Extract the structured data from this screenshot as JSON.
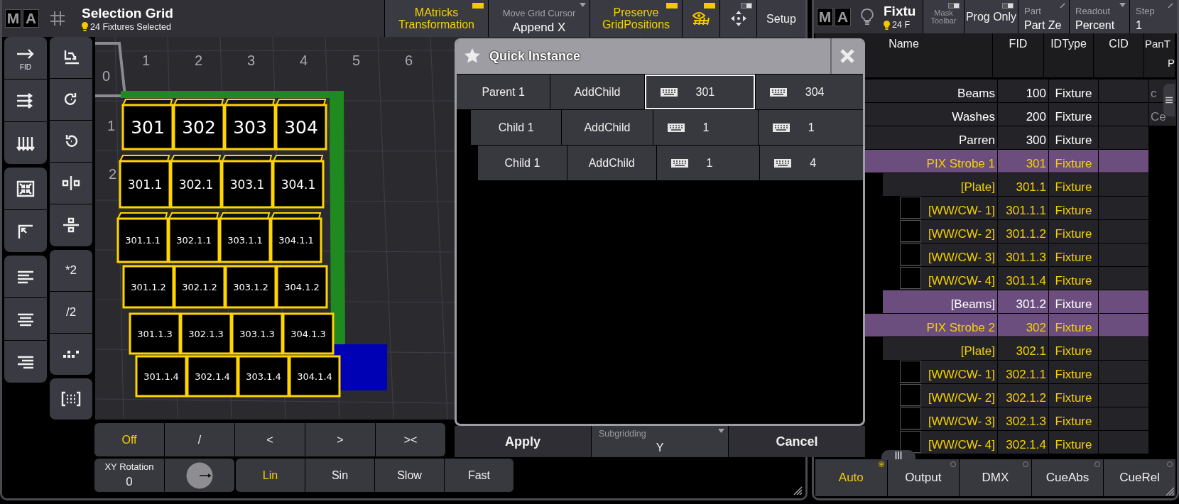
{
  "selection_grid": {
    "logo": [
      "M",
      "A"
    ],
    "title": "Selection Grid",
    "subtitle": "24 Fixtures Selected",
    "toolbar": [
      {
        "kind": "toggle",
        "label": "MAtricks Transformation",
        "on": true
      },
      {
        "kind": "select",
        "caption": "Move Grid Cursor",
        "value": "Append X"
      },
      {
        "kind": "toggle",
        "label": "Preserve GridPositions",
        "on": true
      },
      {
        "kind": "viewtoggle",
        "on": true
      },
      {
        "kind": "movetoggle",
        "on": false
      },
      {
        "kind": "button",
        "label": "Setup"
      }
    ],
    "tools": {
      "fid_label": "FID",
      "multiply_label": "*2",
      "divide_label": "/2"
    },
    "grid": {
      "x_labels": [
        "1",
        "2",
        "3",
        "4",
        "5",
        "6"
      ],
      "y_labels": [
        "0",
        "1",
        "2"
      ],
      "rows": [
        [
          "301",
          "302",
          "303",
          "304"
        ],
        [
          "301.1",
          "302.1",
          "303.1",
          "304.1"
        ],
        [
          "301.1.1",
          "302.1.1",
          "303.1.1",
          "304.1.1"
        ],
        [
          "301.1.2",
          "302.1.2",
          "303.1.2",
          "304.1.2"
        ],
        [
          "301.1.3",
          "302.1.3",
          "303.1.3",
          "304.1.3"
        ],
        [
          "301.1.4",
          "302.1.4",
          "303.1.4",
          "304.1.4"
        ]
      ]
    },
    "fade_modes": [
      {
        "label": "Off",
        "selected": true
      },
      {
        "label": "/",
        "selected": false
      },
      {
        "label": "<",
        "selected": false
      },
      {
        "label": ">",
        "selected": false
      },
      {
        "label": "><",
        "selected": false
      }
    ],
    "xy_rotation": {
      "caption": "XY Rotation",
      "value": "0"
    },
    "curves": [
      {
        "label": "Lin",
        "selected": true
      },
      {
        "label": "Sin",
        "selected": false
      },
      {
        "label": "Slow",
        "selected": false
      },
      {
        "label": "Fast",
        "selected": false
      }
    ]
  },
  "quick_instance": {
    "title": "Quick Instance",
    "rows": [
      {
        "name": "Parent 1",
        "action": "AddChild",
        "from": "301",
        "to": "304",
        "from_focused": true,
        "to_focused": false,
        "children": [
          {
            "name": "Child 1",
            "action": "AddChild",
            "from": "1",
            "to": "1",
            "from_focused": false,
            "to_focused": false,
            "children": [
              {
                "name": "Child 1",
                "action": "AddChild",
                "from": "1",
                "to": "4",
                "from_focused": false,
                "to_focused": false
              }
            ]
          }
        ]
      }
    ],
    "apply": "Apply",
    "subgridding": {
      "caption": "Subgridding",
      "value": "Y"
    },
    "cancel": "Cancel"
  },
  "fixture_sheet": {
    "logo": [
      "M",
      "A"
    ],
    "title": "Fixtu",
    "subtitle": "24 F",
    "toolbar": [
      {
        "kind": "toggle",
        "label": "Mask Toolbar",
        "on": false,
        "disabled": true
      },
      {
        "kind": "toggle",
        "label": "Prog Only",
        "on": false,
        "disabled": false
      },
      {
        "kind": "edit",
        "caption": "Part",
        "value": "Part Ze"
      },
      {
        "kind": "select",
        "caption": "Readout",
        "value": "Percent"
      },
      {
        "kind": "edit",
        "caption": "Step",
        "value": "1"
      }
    ],
    "columns": [
      {
        "label": "Name"
      },
      {
        "label": "FID"
      },
      {
        "label": "IDType"
      },
      {
        "label": "CID"
      },
      {
        "label": "PanT",
        "unit": "P"
      }
    ],
    "rows": [
      {
        "name": "Beams",
        "fid": "100",
        "idtype": "Fixture",
        "column_5": "c",
        "selected": false,
        "highlighted": false
      },
      {
        "name": "Washes",
        "fid": "200",
        "idtype": "Fixture",
        "column_5": "Ce",
        "selected": false,
        "highlighted": false
      },
      {
        "name": "Parren",
        "fid": "300",
        "idtype": "Fixture",
        "selected": false,
        "highlighted": false
      },
      {
        "name": "PIX Strobe 1",
        "fid": "301",
        "idtype": "Fixture",
        "selected": true,
        "highlighted": true,
        "children": [
          {
            "name": "[Plate]",
            "fid": "301.1",
            "idtype": "Fixture",
            "selected": true,
            "highlighted": false,
            "children": [
              {
                "name": "[WW/CW- 1]",
                "fid": "301.1.1",
                "idtype": "Fixture",
                "selected": true,
                "highlighted": false,
                "color": "#000000"
              },
              {
                "name": "[WW/CW- 2]",
                "fid": "301.1.2",
                "idtype": "Fixture",
                "selected": true,
                "highlighted": false,
                "color": "#000000"
              },
              {
                "name": "[WW/CW- 3]",
                "fid": "301.1.3",
                "idtype": "Fixture",
                "selected": true,
                "highlighted": false,
                "color": "#000000"
              },
              {
                "name": "[WW/CW- 4]",
                "fid": "301.1.4",
                "idtype": "Fixture",
                "selected": true,
                "highlighted": false,
                "color": "#000000"
              }
            ]
          },
          {
            "name": "[Beams]",
            "fid": "301.2",
            "idtype": "Fixture",
            "selected": false,
            "highlighted": true
          }
        ]
      },
      {
        "name": "PIX Strobe 2",
        "fid": "302",
        "idtype": "Fixture",
        "selected": true,
        "highlighted": true,
        "children": [
          {
            "name": "[Plate]",
            "fid": "302.1",
            "idtype": "Fixture",
            "selected": true,
            "highlighted": false,
            "children": [
              {
                "name": "[WW/CW- 1]",
                "fid": "302.1.1",
                "idtype": "Fixture",
                "selected": true,
                "highlighted": false,
                "color": "#000000"
              },
              {
                "name": "[WW/CW- 2]",
                "fid": "302.1.2",
                "idtype": "Fixture",
                "selected": true,
                "highlighted": false,
                "color": "#000000"
              },
              {
                "name": "[WW/CW- 3]",
                "fid": "302.1.3",
                "idtype": "Fixture",
                "selected": true,
                "highlighted": false,
                "color": "#000000"
              },
              {
                "name": "[WW/CW- 4]",
                "fid": "302.1.4",
                "idtype": "Fixture",
                "selected": true,
                "highlighted": false,
                "color": "#000000"
              }
            ]
          }
        ]
      }
    ],
    "tabs": [
      {
        "label": "Auto",
        "selected": true
      },
      {
        "label": "Output",
        "selected": false
      },
      {
        "label": "DMX",
        "selected": false
      },
      {
        "label": "CueAbs",
        "selected": false
      },
      {
        "label": "CueRel",
        "selected": false
      }
    ]
  }
}
